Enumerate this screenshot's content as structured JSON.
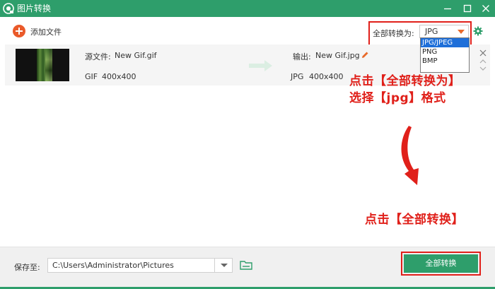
{
  "window": {
    "title": "图片转换",
    "controls": [
      "minimize-icon",
      "maximize-icon",
      "close-icon"
    ]
  },
  "toolbar": {
    "add_files_label": "添加文件",
    "convert_all_to_label": "全部转换为:",
    "format_selected": "JPG",
    "format_options": [
      "JPG/JPEG",
      "PNG",
      "BMP"
    ],
    "highlighted_option": "JPG/JPEG"
  },
  "file": {
    "source_label": "源文件:",
    "source_name": "New Gif.gif",
    "source_format": "GIF",
    "source_size": "400x400",
    "output_label": "输出:",
    "output_name": "New Gif.jpg",
    "output_format": "JPG",
    "output_size": "400x400"
  },
  "annotations": {
    "step1_line1": "点击【全部转换为】",
    "step1_line2": "选择【jpg】格式",
    "step2": "点击【全部转换】"
  },
  "footer": {
    "save_to_label": "保存至:",
    "save_path": "C:\\Users\\Administrator\\Pictures",
    "convert_all_button": "全部转换"
  },
  "colors": {
    "brand_green": "#2e9e6b",
    "accent_orange": "#ea5a2a",
    "annotation_red": "#e0201a",
    "selection_blue": "#1e6fd9"
  }
}
